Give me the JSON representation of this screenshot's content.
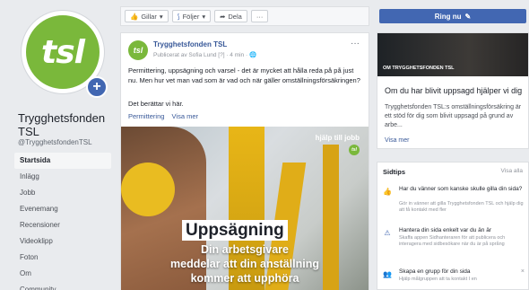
{
  "brand": {
    "accent": "#4267b2",
    "logo_green": "#7ab83b",
    "cta_blue": "#4267b2"
  },
  "sidebar": {
    "avatar_text": "tsl",
    "page_name": "Trygghetsfonden TSL",
    "handle": "@TrygghetsfondenTSL",
    "items": [
      {
        "label": "Startsida",
        "active": true
      },
      {
        "label": "Inlägg"
      },
      {
        "label": "Jobb"
      },
      {
        "label": "Evenemang"
      },
      {
        "label": "Recensioner"
      },
      {
        "label": "Videoklipp"
      },
      {
        "label": "Foton"
      },
      {
        "label": "Om"
      },
      {
        "label": "Community"
      }
    ]
  },
  "toolbar": {
    "like": "Gillar",
    "follow": "Följer",
    "share": "Dela",
    "more": "···"
  },
  "cta": {
    "label": "Ring nu"
  },
  "post": {
    "avatar_text": "tsl",
    "author": "Trygghetsfonden TSL",
    "meta": "Publicerat av Sofia Lund [?] · 4 min · ",
    "text": "Permittering, uppsägning och varsel - det är mycket att hålla reda på på just nu. Men hur vet man vad som är vad och när gäller omställningsförsäkringen?",
    "text2": "Det berättar vi här.",
    "tag": "Permittering",
    "see_more": "Visa mer",
    "more_icon": "···",
    "image": {
      "hashtag": "hjälp till jobb",
      "badge": "tsl",
      "headline": "Uppsägning",
      "sub_lines": [
        "Din arbetsgivare",
        "meddelar att din anställning",
        "kommer att upphöra"
      ]
    }
  },
  "right_card": {
    "caption": "OM TRYGGHETSFONDEN TSL",
    "title": "Om du har blivit uppsagd hjälper vi dig",
    "body": "Trygghetsfonden TSL:s omställningsförsäkring är ett stöd för dig som blivit uppsagd på grund av arbe...",
    "more": "Visa mer"
  },
  "tips": {
    "title": "Sidtips",
    "see_all": "Visa alla",
    "items": [
      {
        "icon": "thumb-icon",
        "title": "Har du vänner som kanske skulle gilla din sida?",
        "body": "Gör in vänner att gilla Trygghetsfonden TSL och hjälp dig att få kontakt med fler"
      },
      {
        "icon": "alert-icon",
        "title": "Hantera din sida enkelt var du än är",
        "body": "Skaffa appen Sidhanteraren för att publicera och interagera med sidbesökare när du är på språng"
      },
      {
        "icon": "group-icon",
        "title": "Skapa en grupp för din sida",
        "body": "Hjälp målgruppen att ta kontakt I en"
      }
    ]
  }
}
